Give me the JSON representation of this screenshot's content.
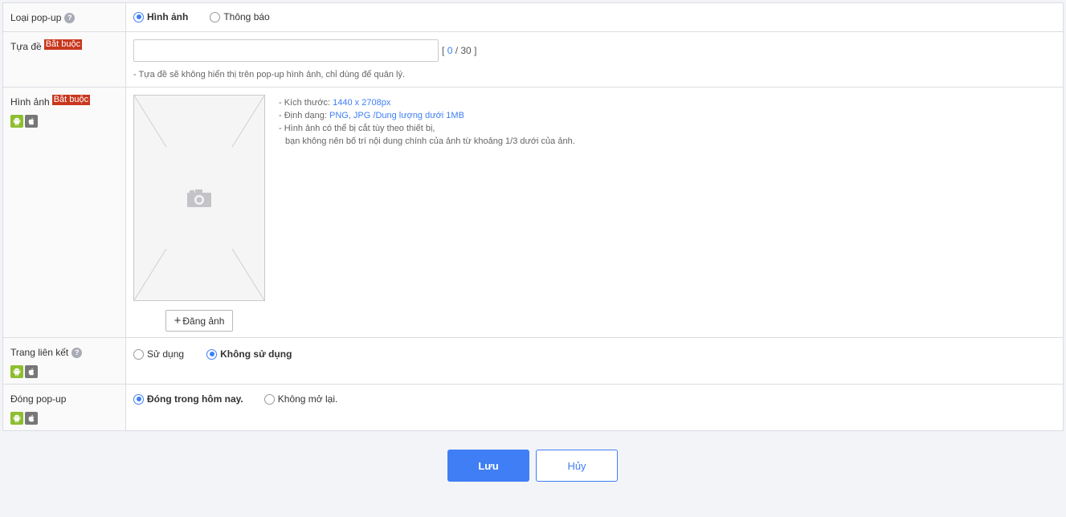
{
  "popup_type": {
    "label": "Loại pop-up",
    "help": "?",
    "options": [
      {
        "label": "Hình ảnh",
        "checked": true
      },
      {
        "label": "Thông báo",
        "checked": false
      }
    ]
  },
  "title_field": {
    "label": "Tựa đề",
    "required": "Bắt buộc",
    "value": "",
    "placeholder": "",
    "counter_open": "[",
    "counter_current": "0",
    "counter_sep": "/ 30 ]",
    "hint": "- Tựa đề sẽ không hiển thị trên pop-up hình ảnh, chỉ dùng để quản lý."
  },
  "image_field": {
    "label": "Hình ảnh",
    "required": "Bắt buộc",
    "upload_button": "Đăng ảnh",
    "info": {
      "size_label": "- Kích thước: ",
      "size_value": "1440 x 2708px",
      "format_label": "- Định dạng: ",
      "format_value": "PNG, JPG /Dung lượng dưới 1MB",
      "crop_line1": "- Hình ảnh có thể bị cắt tùy theo thiết bị,",
      "crop_line2": "bạn không nên bố trí nội dung chính của ảnh từ khoảng 1/3 dưới của ảnh."
    }
  },
  "link_page": {
    "label": "Trang liên kết",
    "help": "?",
    "options": [
      {
        "label": "Sử dụng",
        "checked": false
      },
      {
        "label": "Không sử dụng",
        "checked": true
      }
    ]
  },
  "close_popup": {
    "label": "Đóng pop-up",
    "options": [
      {
        "label": "Đóng trong hôm nay.",
        "checked": true
      },
      {
        "label": "Không mở lại.",
        "checked": false
      }
    ]
  },
  "actions": {
    "save": "Lưu",
    "cancel": "Hủy"
  },
  "icons": {
    "android": "android-icon",
    "apple": "apple-icon",
    "camera": "camera-icon"
  },
  "colors": {
    "accent": "#3f7ef5",
    "required_badge": "#c8371d",
    "android": "#8dbe2e",
    "apple": "#777777"
  }
}
